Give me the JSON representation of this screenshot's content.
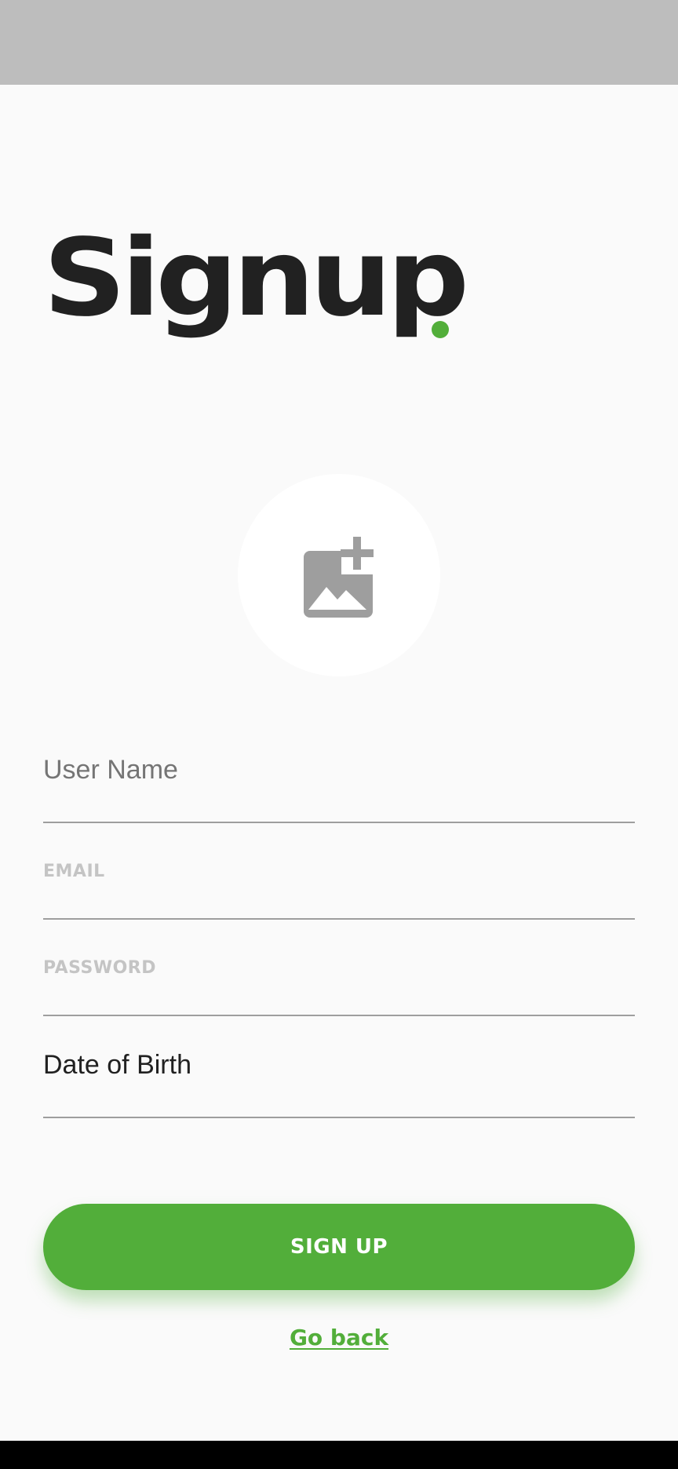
{
  "page": {
    "title": "Signup"
  },
  "avatar": {
    "icon": "add-photo-icon"
  },
  "form": {
    "username_placeholder": "User Name",
    "email_placeholder": "EMAIL",
    "password_placeholder": "PASSWORD",
    "dob_placeholder": "Date of Birth"
  },
  "actions": {
    "signup_label": "SIGN UP",
    "go_back_label": "Go back"
  },
  "colors": {
    "accent": "#52ae3a",
    "title": "#212121",
    "status_bar": "#bdbdbd",
    "background": "#fafafa",
    "icon_gray": "#9e9e9e"
  }
}
